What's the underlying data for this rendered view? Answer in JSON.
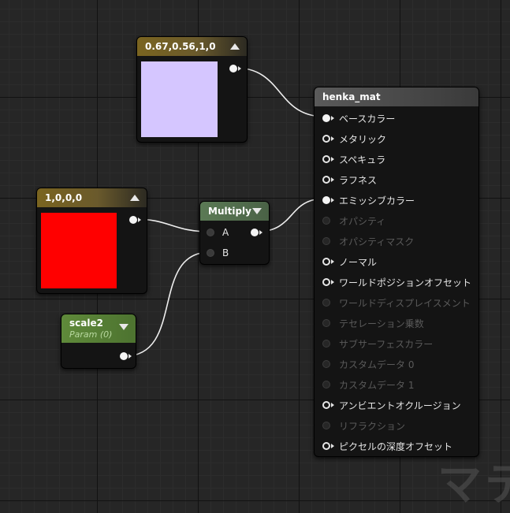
{
  "colors": {
    "const3_swatch": "#d5c6ff",
    "const1_swatch": "#ff0000",
    "wire": "#eeeeee"
  },
  "nodes": {
    "const3": {
      "title": "0.67,0.56,1,0"
    },
    "const1": {
      "title": "1,0,0,0"
    },
    "scale": {
      "title": "scale2",
      "subtitle": "Param (0)"
    },
    "multiply": {
      "title": "Multiply",
      "inputs": [
        "A",
        "B"
      ]
    },
    "material": {
      "title": "henka_mat",
      "pins": [
        {
          "label": "ベースカラー",
          "state": "connected"
        },
        {
          "label": "メタリック",
          "state": "enabled"
        },
        {
          "label": "スペキュラ",
          "state": "enabled"
        },
        {
          "label": "ラフネス",
          "state": "enabled"
        },
        {
          "label": "エミッシブカラー",
          "state": "connected"
        },
        {
          "label": "オパシティ",
          "state": "disabled"
        },
        {
          "label": "オパシティマスク",
          "state": "disabled"
        },
        {
          "label": "ノーマル",
          "state": "enabled"
        },
        {
          "label": "ワールドポジションオフセット",
          "state": "enabled"
        },
        {
          "label": "ワールドディスプレイスメント",
          "state": "disabled"
        },
        {
          "label": "テセレーション乗数",
          "state": "disabled"
        },
        {
          "label": "サブサーフェスカラー",
          "state": "disabled"
        },
        {
          "label": "カスタムデータ 0",
          "state": "disabled"
        },
        {
          "label": "カスタムデータ 1",
          "state": "disabled"
        },
        {
          "label": "アンビエントオクルージョン",
          "state": "enabled"
        },
        {
          "label": "リフラクション",
          "state": "disabled"
        },
        {
          "label": "ピクセルの深度オフセット",
          "state": "enabled"
        }
      ]
    }
  },
  "watermark": "マテ"
}
